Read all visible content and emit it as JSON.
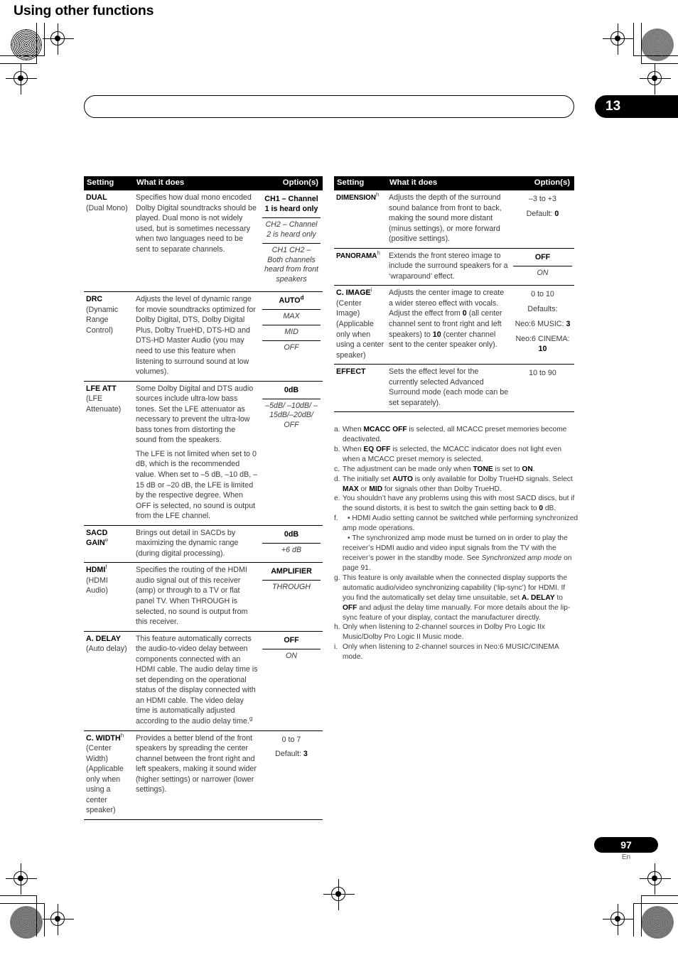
{
  "header": {
    "chapter_title": "Using other functions",
    "chapter_number": "13"
  },
  "footer": {
    "page_number": "97",
    "language_code": "En"
  },
  "tables": [
    {
      "id": "left",
      "columns": [
        "Setting",
        "What it does",
        "Option(s)"
      ],
      "rows": [
        {
          "setting_bold": "DUAL",
          "setting_rest": "(Dual Mono)",
          "setting_sup": "",
          "description": "Specifies how dual mono encoded Dolby Digital soundtracks should be played. Dual mono is not widely used, but is sometimes necessary when two languages need to be sent to separate channels.",
          "options": [
            {
              "text": "CH1 – Channel 1 is heard only",
              "style": "first"
            },
            {
              "text": "CH2 – Channel 2 is heard only",
              "style": "sep"
            },
            {
              "text": "CH1 CH2 – Both channels heard from front speakers",
              "style": "sep"
            }
          ]
        },
        {
          "setting_bold": "DRC",
          "setting_rest": "(Dynamic Range Control)",
          "setting_sup": "",
          "description": "Adjusts the level of dynamic range for movie soundtracks optimized for Dolby Digital, DTS, Dolby Digital Plus, Dolby TrueHD, DTS-HD and DTS-HD Master Audio (you may need to use this feature when listening to surround sound at low volumes).",
          "options": [
            {
              "text": "AUTO",
              "sup": "d",
              "style": "first"
            },
            {
              "text": "MAX",
              "style": "sep"
            },
            {
              "text": "MID",
              "style": "sep"
            },
            {
              "text": "OFF",
              "style": "sep"
            }
          ]
        },
        {
          "setting_bold": "LFE ATT",
          "setting_rest": "(LFE Attenuate)",
          "setting_sup": "",
          "description": "Some Dolby Digital and DTS audio sources include ultra-low bass tones. Set the LFE attenuator as necessary to prevent the ultra-low bass tones from distorting the sound from the speakers.",
          "description2": "The LFE is not limited when set to 0 dB, which is the recommended value. When set to –5 dB, –10 dB, –15 dB or –20 dB, the LFE is limited by the respective degree. When OFF is selected, no sound is output from the LFE channel.",
          "options": [
            {
              "text": "0dB",
              "style": "first"
            },
            {
              "text": "–5dB/ –10dB/ –15dB/–20dB/ OFF",
              "style": "sep"
            }
          ]
        },
        {
          "setting_bold": "SACD GAIN",
          "setting_rest": "",
          "setting_sup": "e",
          "description": "Brings out detail in SACDs by maximizing the dynamic range (during digital processing).",
          "options": [
            {
              "text": "0dB",
              "style": "first"
            },
            {
              "text": "+6 dB",
              "style": "sep"
            }
          ]
        },
        {
          "setting_bold": "HDMI",
          "setting_sup": "f",
          "setting_rest": "(HDMI Audio)",
          "description": "Specifies the routing of the HDMI audio signal out of this receiver (amp) or through to a TV or flat panel TV. When THROUGH is selected, no sound is output from this receiver.",
          "options": [
            {
              "text": "AMPLIFIER",
              "style": "first"
            },
            {
              "text": "THROUGH",
              "style": "sep"
            }
          ]
        },
        {
          "setting_bold": "A. DELAY",
          "setting_rest": "(Auto delay)",
          "setting_sup": "",
          "description": "This feature automatically corrects the audio-to-video delay between components connected with an HDMI cable. The audio delay time is set depending on the operational status of the display connected with an HDMI cable. The video delay time is automatically adjusted according to the audio delay time.",
          "description_sup": "g",
          "options": [
            {
              "text": "OFF",
              "style": "first"
            },
            {
              "text": "ON",
              "style": "sep"
            }
          ]
        },
        {
          "setting_bold": "C. WIDTH",
          "setting_sup": "h",
          "setting_rest": "(Center Width) (Applicable only when using a center speaker)",
          "description": "Provides a better blend of the front speakers by spreading the center channel between the front right and left speakers, making it sound wider (higher settings) or narrower (lower settings).",
          "options": [
            {
              "text": "0 to 7",
              "style": "plain"
            },
            {
              "text": "Default: 3",
              "bold_part": "3",
              "style": "plain"
            }
          ]
        }
      ]
    },
    {
      "id": "right",
      "columns": [
        "Setting",
        "What it does",
        "Option(s)"
      ],
      "rows": [
        {
          "setting_bold": "DIMENSION",
          "setting_sup": "h",
          "setting_rest": "",
          "setting_small": true,
          "description": "Adjusts the depth of the surround sound balance from front to back, making the sound more distant (minus settings), or more forward (positive settings).",
          "options": [
            {
              "text": "–3 to +3",
              "style": "plain"
            },
            {
              "text": "Default: 0",
              "bold_part": "0",
              "style": "plain"
            }
          ]
        },
        {
          "setting_bold": "PANORAMA",
          "setting_sup": "h",
          "setting_rest": "",
          "setting_small": true,
          "description": "Extends the front stereo image to include the surround speakers for a ‘wraparound’ effect.",
          "options": [
            {
              "text": "OFF",
              "style": "first"
            },
            {
              "text": "ON",
              "style": "sep"
            }
          ]
        },
        {
          "setting_bold": "C. IMAGE",
          "setting_sup": "i",
          "setting_rest": "(Center Image) (Applicable only when using a center speaker)",
          "description": "Adjusts the center image to create a wider stereo effect with vocals. Adjust the effect from 0 (all center channel sent to front right and left speakers) to 10 (center channel sent to the center speaker only).",
          "options": [
            {
              "text": "0 to 10",
              "style": "plain"
            },
            {
              "text": "Defaults:",
              "style": "plain"
            },
            {
              "text": "Neo:6 MUSIC: 3",
              "bold_part": "3",
              "style": "plain"
            },
            {
              "text": "Neo:6 CINEMA: 10",
              "bold_part": "10",
              "style": "plain"
            }
          ]
        },
        {
          "setting_bold": "EFFECT",
          "setting_rest": "",
          "setting_sup": "",
          "description": "Sets the effect level for the currently selected Advanced Surround mode (each mode can be set separately).",
          "options": [
            {
              "text": "10 to 90",
              "style": "plain"
            }
          ]
        }
      ]
    }
  ],
  "footnotes": [
    {
      "mark": "a.",
      "html": "When <b>MCACC OFF</b> is selected, all MCACC preset memories become deactivated."
    },
    {
      "mark": "b.",
      "html": "When <b>EQ OFF</b> is selected, the MCACC indicator does not light even when a MCACC preset memory is selected."
    },
    {
      "mark": "c.",
      "html": "The adjustment can be made only when <b>TONE</b> is set to <b>ON</b>."
    },
    {
      "mark": "d.",
      "html": "The initially set <b>AUTO</b> is only available for Dolby TrueHD signals. Select <b>MAX</b> or <b>MID</b> for signals other than Dolby TrueHD."
    },
    {
      "mark": "e.",
      "html": "You shouldn’t have any problems using this with most SACD discs, but if the sound distorts, it is best to switch the gain setting back to <b>0</b> dB."
    },
    {
      "mark": "f.",
      "html": "<span class=\"bullet-line\">• HDMI Audio setting cannot be switched while performing synchronized amp mode operations.</span><span class=\"bullet-line\">• The synchronized amp mode must be turned on in order to play the receiver’s HDMI audio and video input signals from the TV with the receiver’s power in the standby mode. See <i>Synchronized amp mode</i> on page 91.</span>"
    },
    {
      "mark": "g.",
      "html": "This feature is only available when the connected display supports the automatic audio/video synchronizing capability (‘lip-sync’) for HDMI. If you find the automatically set delay time unsuitable, set <b>A. DELAY</b> to <b>OFF</b> and adjust the delay time manually. For more details about the lip-sync feature of your display, contact the manufacturer directly."
    },
    {
      "mark": "h.",
      "html": "Only when listening to 2-channel sources in Dolby Pro Logic IIx Music/Dolby Pro Logic II Music mode."
    },
    {
      "mark": "i.",
      "html": "Only when listening to 2-channel sources in Neo:6 MUSIC/CINEMA mode."
    }
  ]
}
